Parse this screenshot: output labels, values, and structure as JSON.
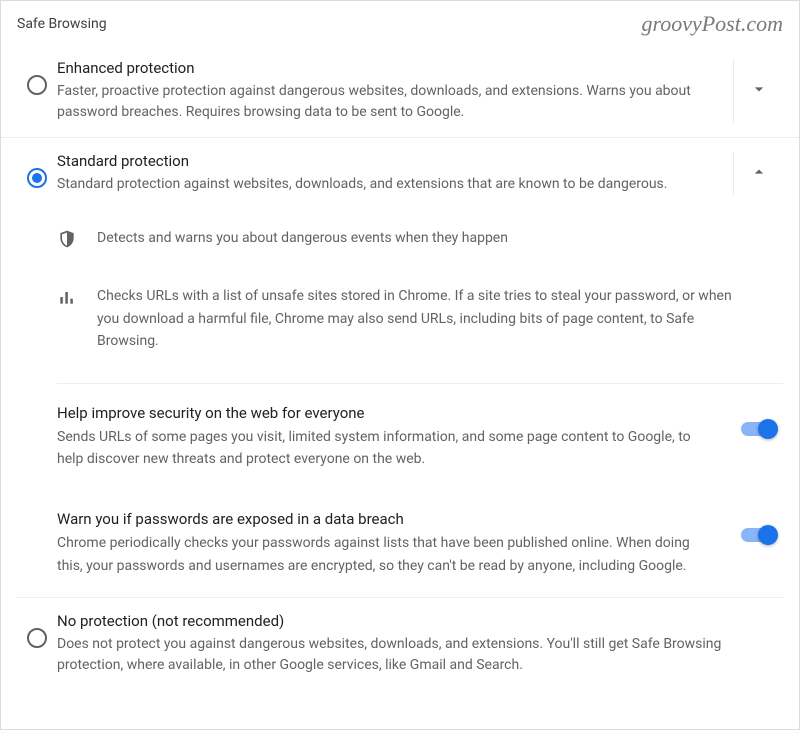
{
  "header": {
    "title": "Safe Browsing",
    "watermark": "groovyPost.com"
  },
  "options": {
    "enhanced": {
      "title": "Enhanced protection",
      "desc": "Faster, proactive protection against dangerous websites, downloads, and extensions. Warns you about password breaches. Requires browsing data to be sent to Google."
    },
    "standard": {
      "title": "Standard protection",
      "desc": "Standard protection against websites, downloads, and extensions that are known to be dangerous.",
      "detail1": "Detects and warns you about dangerous events when they happen",
      "detail2": "Checks URLs with a list of unsafe sites stored in Chrome. If a site tries to steal your password, or when you download a harmful file, Chrome may also send URLs, including bits of page content, to Safe Browsing.",
      "sub1": {
        "title": "Help improve security on the web for everyone",
        "desc": "Sends URLs of some pages you visit, limited system information, and some page content to Google, to help discover new threats and protect everyone on the web."
      },
      "sub2": {
        "title": "Warn you if passwords are exposed in a data breach",
        "desc": "Chrome periodically checks your passwords against lists that have been published online. When doing this, your passwords and usernames are encrypted, so they can't be read by anyone, including Google."
      }
    },
    "none": {
      "title": "No protection (not recommended)",
      "desc": "Does not protect you against dangerous websites, downloads, and extensions. You'll still get Safe Browsing protection, where available, in other Google services, like Gmail and Search."
    }
  }
}
